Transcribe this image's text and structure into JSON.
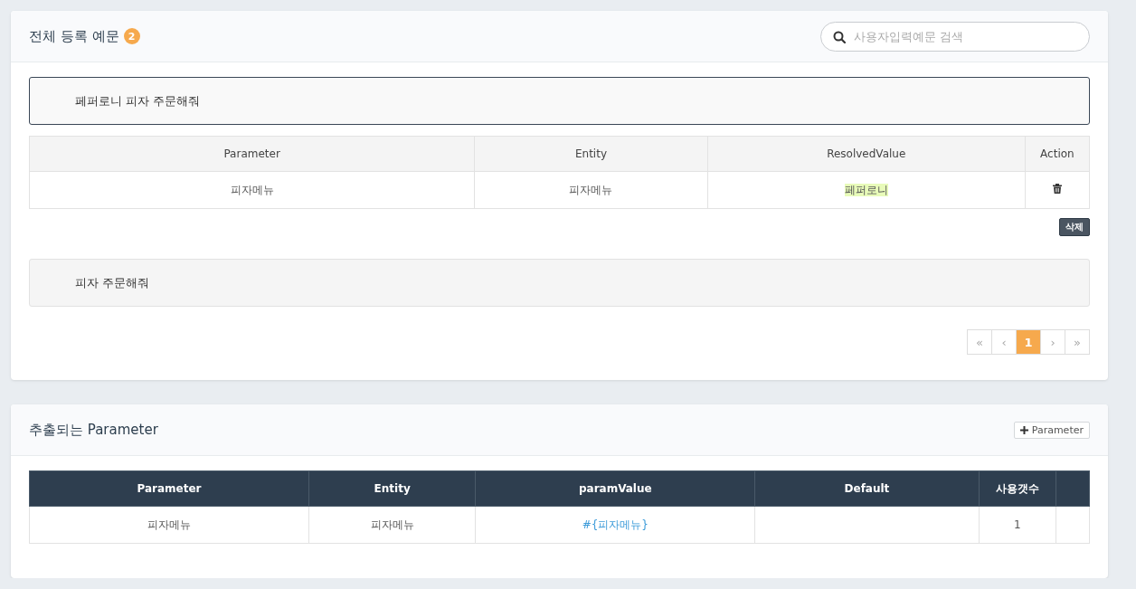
{
  "examples_panel": {
    "title": "전체 등록 예문",
    "count": "2",
    "search": {
      "placeholder": "사용자입력예문 검색"
    },
    "columns": [
      "Parameter",
      "Entity",
      "ResolvedValue",
      "Action"
    ],
    "examples": [
      {
        "text": "페퍼로니 피자 주문해줘",
        "selected": true,
        "rows": [
          {
            "parameter": "피자메뉴",
            "entity": "피자메뉴",
            "resolved_value": "페퍼로니",
            "highlighted": true
          }
        ],
        "delete_label": "삭제"
      },
      {
        "text": "피자 주문해줘",
        "selected": false
      }
    ],
    "pagination": {
      "first": "«",
      "prev": "‹",
      "pages": [
        {
          "label": "1",
          "selected": true
        }
      ],
      "next": "›",
      "last": "»"
    }
  },
  "parameters_panel": {
    "title": "추출되는 Parameter",
    "add_button": "Parameter",
    "columns": [
      "Parameter",
      "Entity",
      "paramValue",
      "Default",
      "사용갯수",
      ""
    ],
    "rows": [
      {
        "parameter": "피자메뉴",
        "entity": "피자메뉴",
        "param_value": "#{피자메뉴}",
        "default": "",
        "usage_count": "1"
      }
    ]
  }
}
